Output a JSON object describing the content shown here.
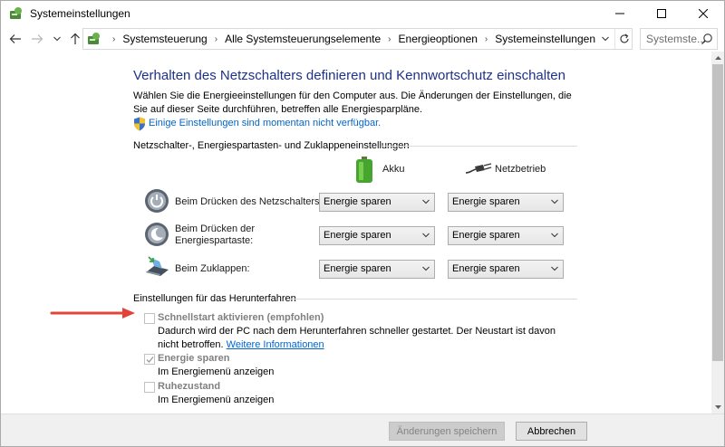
{
  "window": {
    "title": "Systemeinstellungen"
  },
  "address": {
    "crumbs": [
      "Systemsteuerung",
      "Alle Systemsteuerungselemente",
      "Energieoptionen",
      "Systemeinstellungen"
    ],
    "search_placeholder": "Systemste..."
  },
  "page": {
    "heading": "Verhalten des Netzschalters definieren und Kennwortschutz einschalten",
    "description": "Wählen Sie die Energieeinstellungen für den Computer aus. Die Änderungen der Einstellungen, die Sie auf dieser Seite durchführen, betreffen alle Energiesparpläne.",
    "unavailable_link": "Einige Einstellungen sind momentan nicht verfügbar.",
    "power_group_title": "Netzschalter-, Energiespartasten- und Zuklappeneinstellungen",
    "col_battery": "Akku",
    "col_plugged": "Netzbetrieb",
    "rows": [
      {
        "label": "Beim Drücken des Netzschalters:",
        "battery": "Energie sparen",
        "plugged": "Energie sparen"
      },
      {
        "label": "Beim Drücken der Energiespartaste:",
        "battery": "Energie sparen",
        "plugged": "Energie sparen"
      },
      {
        "label": "Beim Zuklappen:",
        "battery": "Energie sparen",
        "plugged": "Energie sparen"
      }
    ],
    "shutdown_group_title": "Einstellungen für das Herunterfahren",
    "options": [
      {
        "title": "Schnellstart aktivieren (empfohlen)",
        "desc": "Dadurch wird der PC nach dem Herunterfahren schneller gestartet. Der Neustart ist davon nicht betroffen.",
        "link": "Weitere Informationen",
        "checked": false
      },
      {
        "title": "Energie sparen",
        "desc": "Im Energiemenü anzeigen",
        "checked": true
      },
      {
        "title": "Ruhezustand",
        "desc": "Im Energiemenü anzeigen",
        "checked": false
      }
    ]
  },
  "footer": {
    "save_label": "Änderungen speichern",
    "cancel_label": "Abbrechen"
  },
  "colors": {
    "heading": "#1e3287",
    "link": "#0066cc",
    "arrow": "#e2443a"
  }
}
